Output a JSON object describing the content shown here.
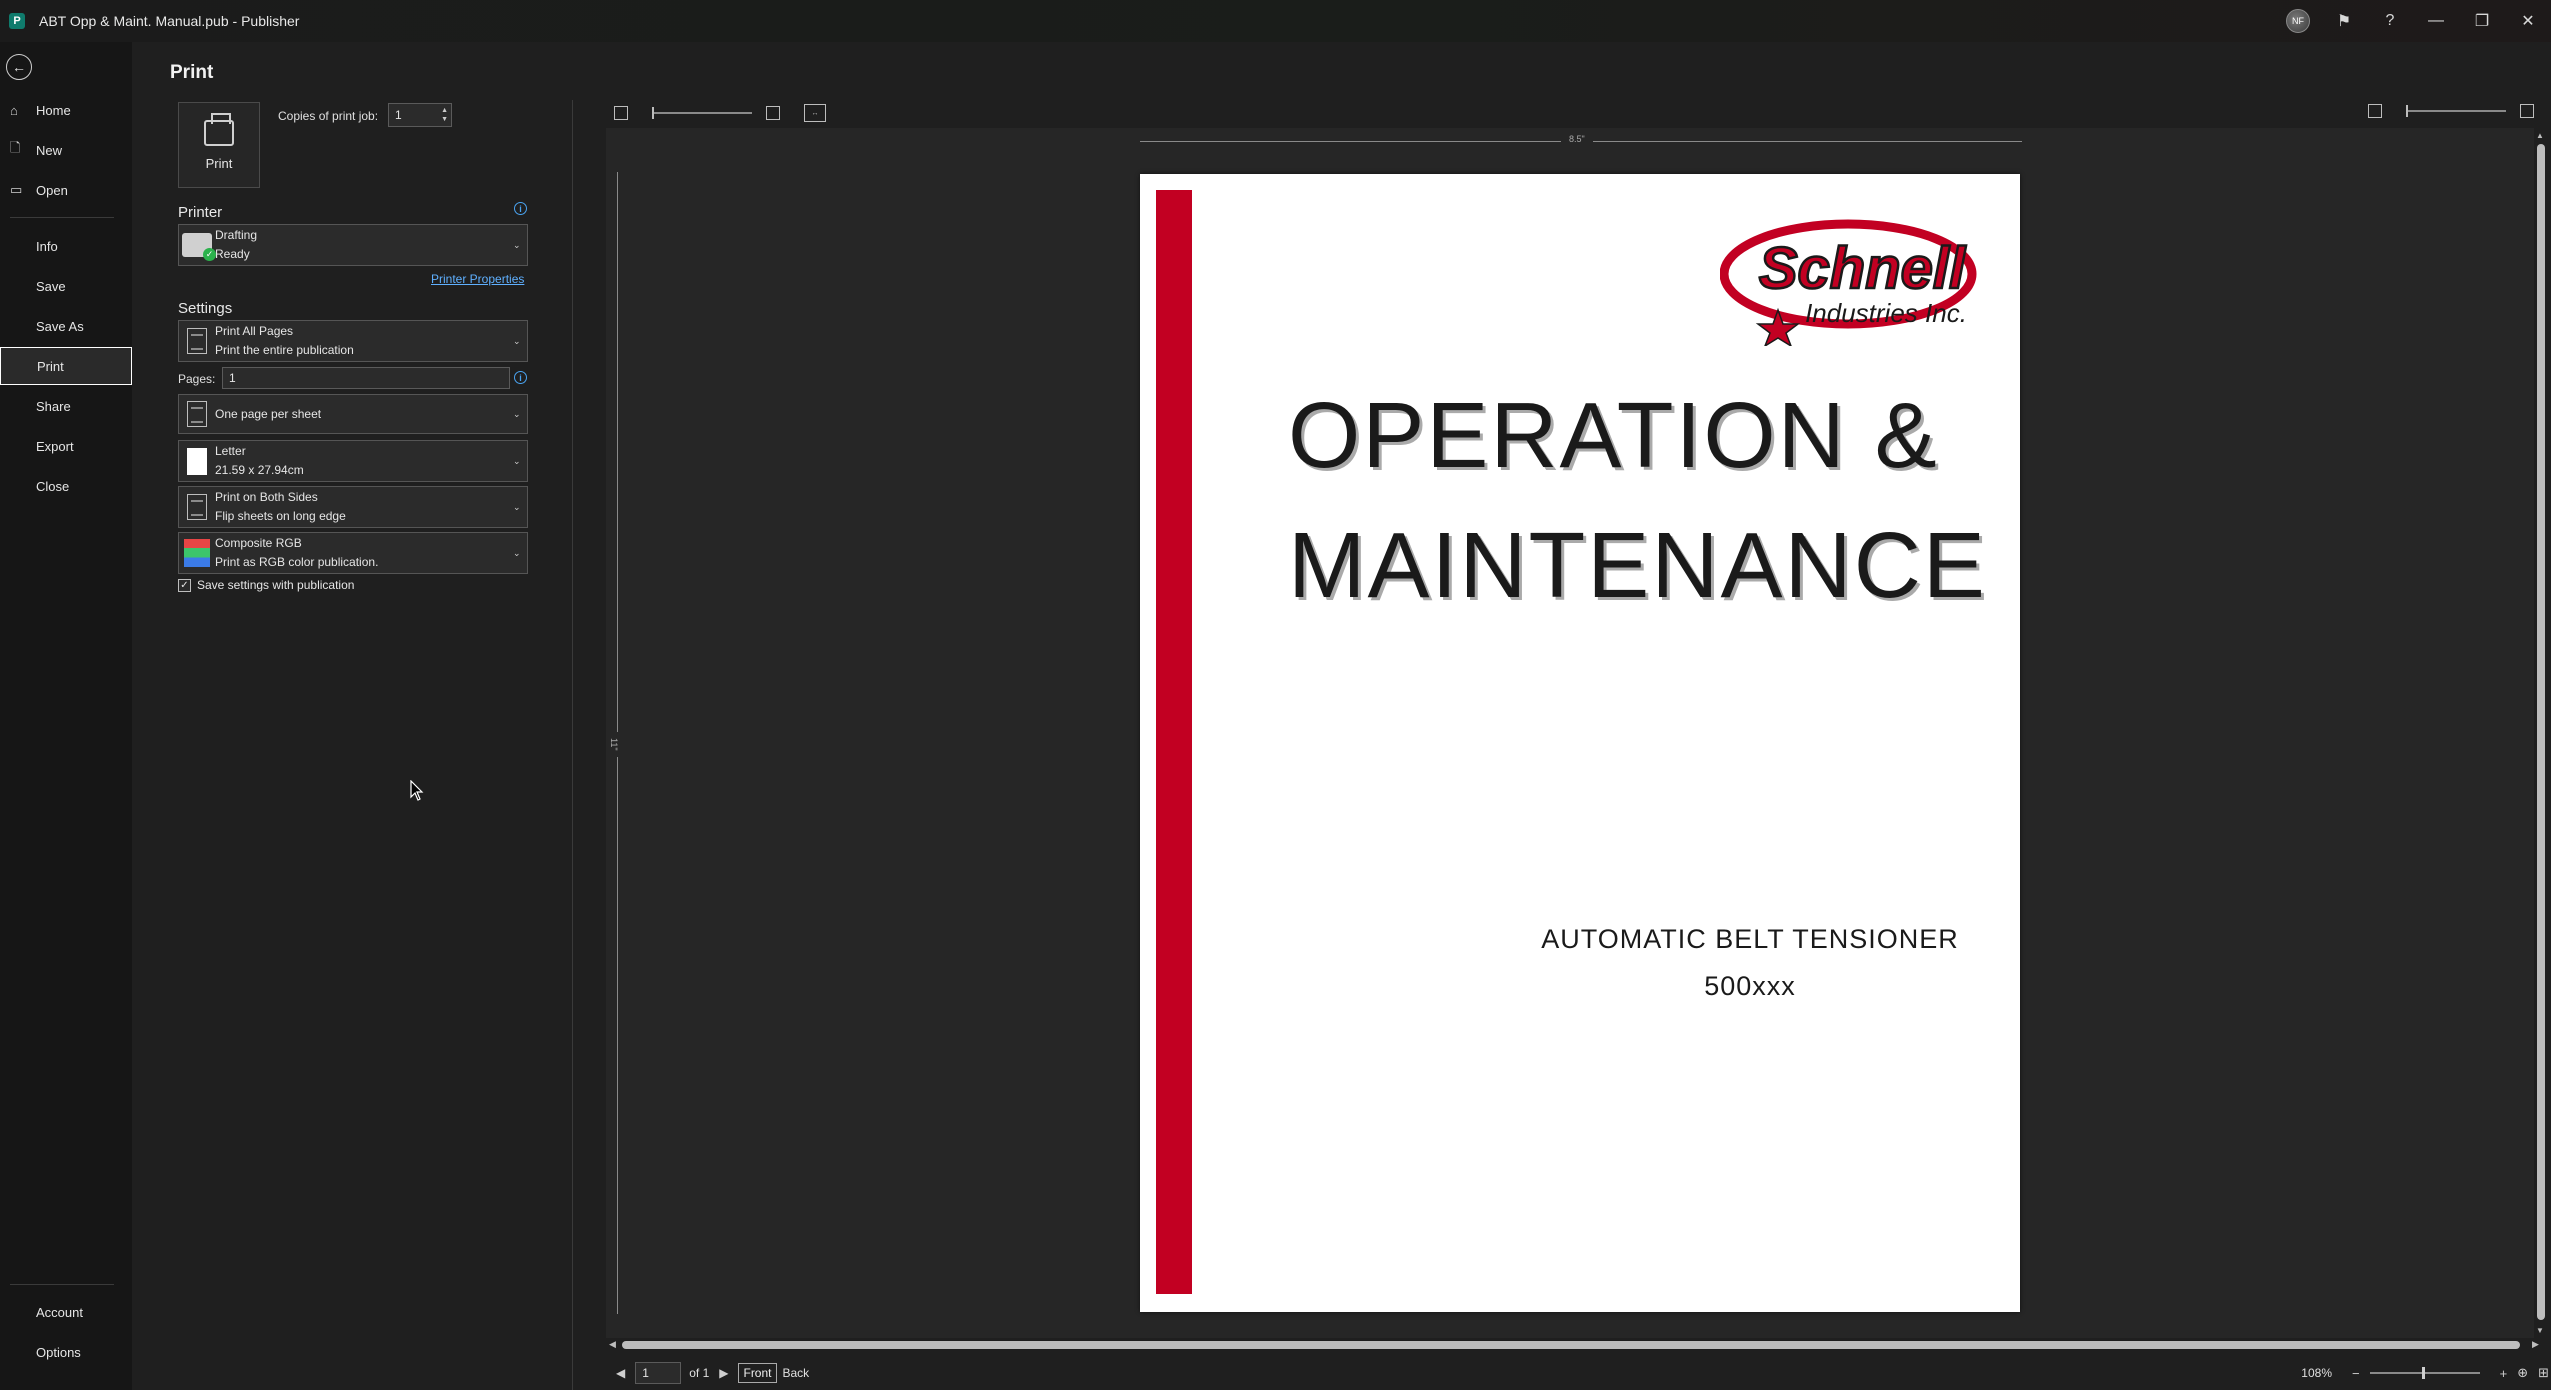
{
  "window": {
    "title": "ABT Opp & Maint. Manual.pub  -  Publisher",
    "avatar_initials": "NF",
    "controls": [
      "minimize-icon",
      "restore-icon",
      "close-icon"
    ]
  },
  "nav": {
    "items": [
      {
        "label": "Home",
        "icon": "home-icon"
      },
      {
        "label": "New",
        "icon": "new-file-icon"
      },
      {
        "label": "Open",
        "icon": "folder-icon"
      },
      {
        "label": "Info"
      },
      {
        "label": "Save"
      },
      {
        "label": "Save As"
      },
      {
        "label": "Print",
        "active": true
      },
      {
        "label": "Share"
      },
      {
        "label": "Export"
      },
      {
        "label": "Close"
      }
    ],
    "bottom": [
      {
        "label": "Account"
      },
      {
        "label": "Options"
      }
    ]
  },
  "print": {
    "heading": "Print",
    "button_label": "Print",
    "copies_label": "Copies of print job:",
    "copies_value": "1",
    "printer_section": "Printer",
    "printer_name": "Drafting",
    "printer_status": "Ready",
    "printer_properties": "Printer Properties",
    "settings_section": "Settings",
    "range_title": "Print All Pages",
    "range_desc": "Print the entire publication",
    "pages_label": "Pages:",
    "pages_value": "1",
    "layout_title": "One page per sheet",
    "paper_title": "Letter",
    "paper_desc": "21.59 x 27.94cm",
    "duplex_title": "Print on Both Sides",
    "duplex_desc": "Flip sheets on long edge",
    "color_title": "Composite RGB",
    "color_desc": "Print as RGB color publication.",
    "save_settings_label": "Save settings with publication",
    "save_settings_checked": true
  },
  "preview": {
    "ruler_h_label": "8.5\"",
    "ruler_v_label": "11\"",
    "page_title_line1": "OPERATION &",
    "page_title_line2": "MAINTENANCE",
    "page_subtitle": "AUTOMATIC BELT TENSIONER",
    "page_model": "500xxx",
    "logo_word1": "Schnell",
    "logo_word2": "Industries Inc.",
    "accent_color": "#c20022"
  },
  "status": {
    "page_value": "1",
    "page_of": "of 1",
    "front_label": "Front",
    "back_label": "Back",
    "zoom": "108%"
  }
}
